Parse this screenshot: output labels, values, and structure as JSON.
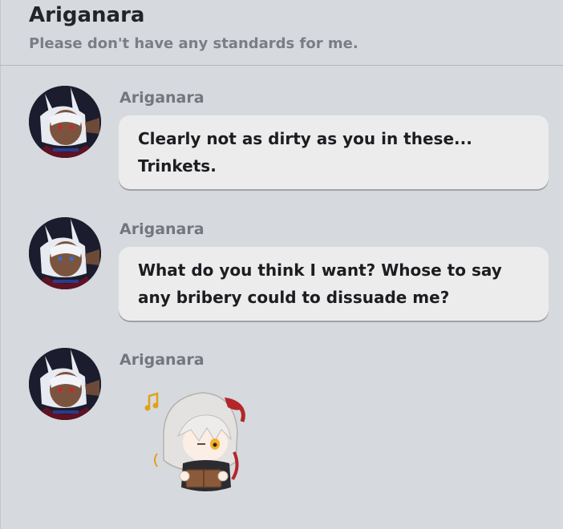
{
  "header": {
    "name": "Ariganara",
    "status": "Please don't have any standards for me."
  },
  "messages": [
    {
      "sender": "Ariganara",
      "avatar_icon": "character-avatar-icon",
      "text": "Clearly not as dirty as you in these... Trinkets."
    },
    {
      "sender": "Ariganara",
      "avatar_icon": "character-avatar-icon",
      "text": "What do you think I want? Whose to say any bribery could to dissuade me?"
    },
    {
      "sender": "Ariganara",
      "avatar_icon": "character-avatar-icon",
      "sticker_icon": "chibi-character-sticker-icon"
    }
  ],
  "colors": {
    "background": "#d6d9dd",
    "bubble": "#ececed",
    "sender_text": "#73777d",
    "accent_red": "#b3262a"
  }
}
